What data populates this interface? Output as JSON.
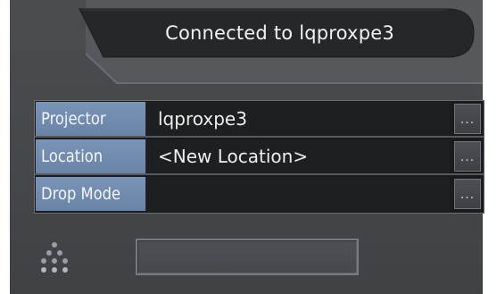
{
  "header": {
    "status": "Connected to lqproxpe3"
  },
  "fields": [
    {
      "label": "Projector",
      "value": "lqproxpe3",
      "button_label": "..."
    },
    {
      "label": "Location",
      "value": "<New Location>",
      "button_label": "..."
    },
    {
      "label": "Drop Mode",
      "value": "",
      "button_label": "..."
    }
  ],
  "footer": {
    "action_button_label": "",
    "spinner_icon": "busy-dots-icon"
  },
  "colors": {
    "panel": "#45484b",
    "label_background": "#7088ac",
    "value_background": "#1e1f20",
    "text": "#f2f2f2"
  }
}
